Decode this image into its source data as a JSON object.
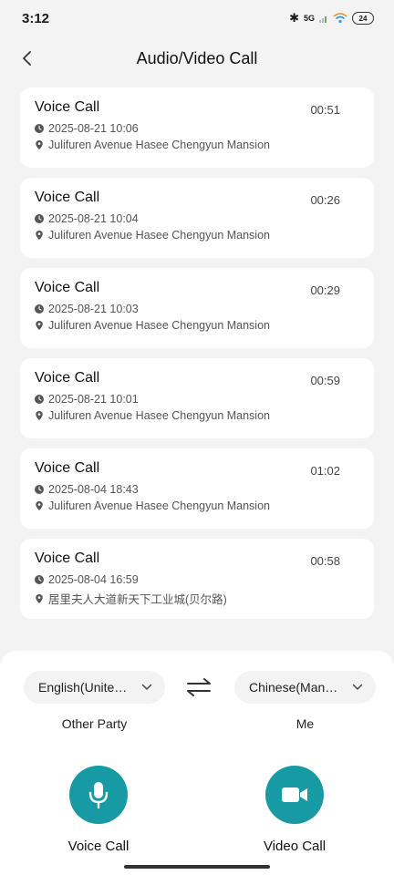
{
  "status_bar": {
    "time": "3:12",
    "network": "5G",
    "battery": "24"
  },
  "header": {
    "title": "Audio/Video Call"
  },
  "calls": [
    {
      "type": "Voice Call",
      "duration": "00:51",
      "datetime": "2025-08-21 10:06",
      "location": "Julifuren Avenue Hasee Chengyun Mansion"
    },
    {
      "type": "Voice Call",
      "duration": "00:26",
      "datetime": "2025-08-21 10:04",
      "location": "Julifuren Avenue Hasee Chengyun Mansion"
    },
    {
      "type": "Voice Call",
      "duration": "00:29",
      "datetime": "2025-08-21 10:03",
      "location": "Julifuren Avenue Hasee Chengyun Mansion"
    },
    {
      "type": "Voice Call",
      "duration": "00:59",
      "datetime": "2025-08-21 10:01",
      "location": "Julifuren Avenue Hasee Chengyun Mansion"
    },
    {
      "type": "Voice Call",
      "duration": "01:02",
      "datetime": "2025-08-04 18:43",
      "location": "Julifuren Avenue Hasee Chengyun Mansion"
    },
    {
      "type": "Voice Call",
      "duration": "00:58",
      "datetime": "2025-08-04 16:59",
      "location": "居里夫人大道新天下工业城(贝尔路)"
    }
  ],
  "languages": {
    "other_party": "English(Unite…",
    "me": "Chinese(Man…",
    "other_party_label": "Other Party",
    "me_label": "Me"
  },
  "actions": {
    "voice_label": "Voice Call",
    "video_label": "Video Call"
  },
  "colors": {
    "accent": "#179aa4",
    "background": "#f3f3f3",
    "card": "#ffffff"
  }
}
